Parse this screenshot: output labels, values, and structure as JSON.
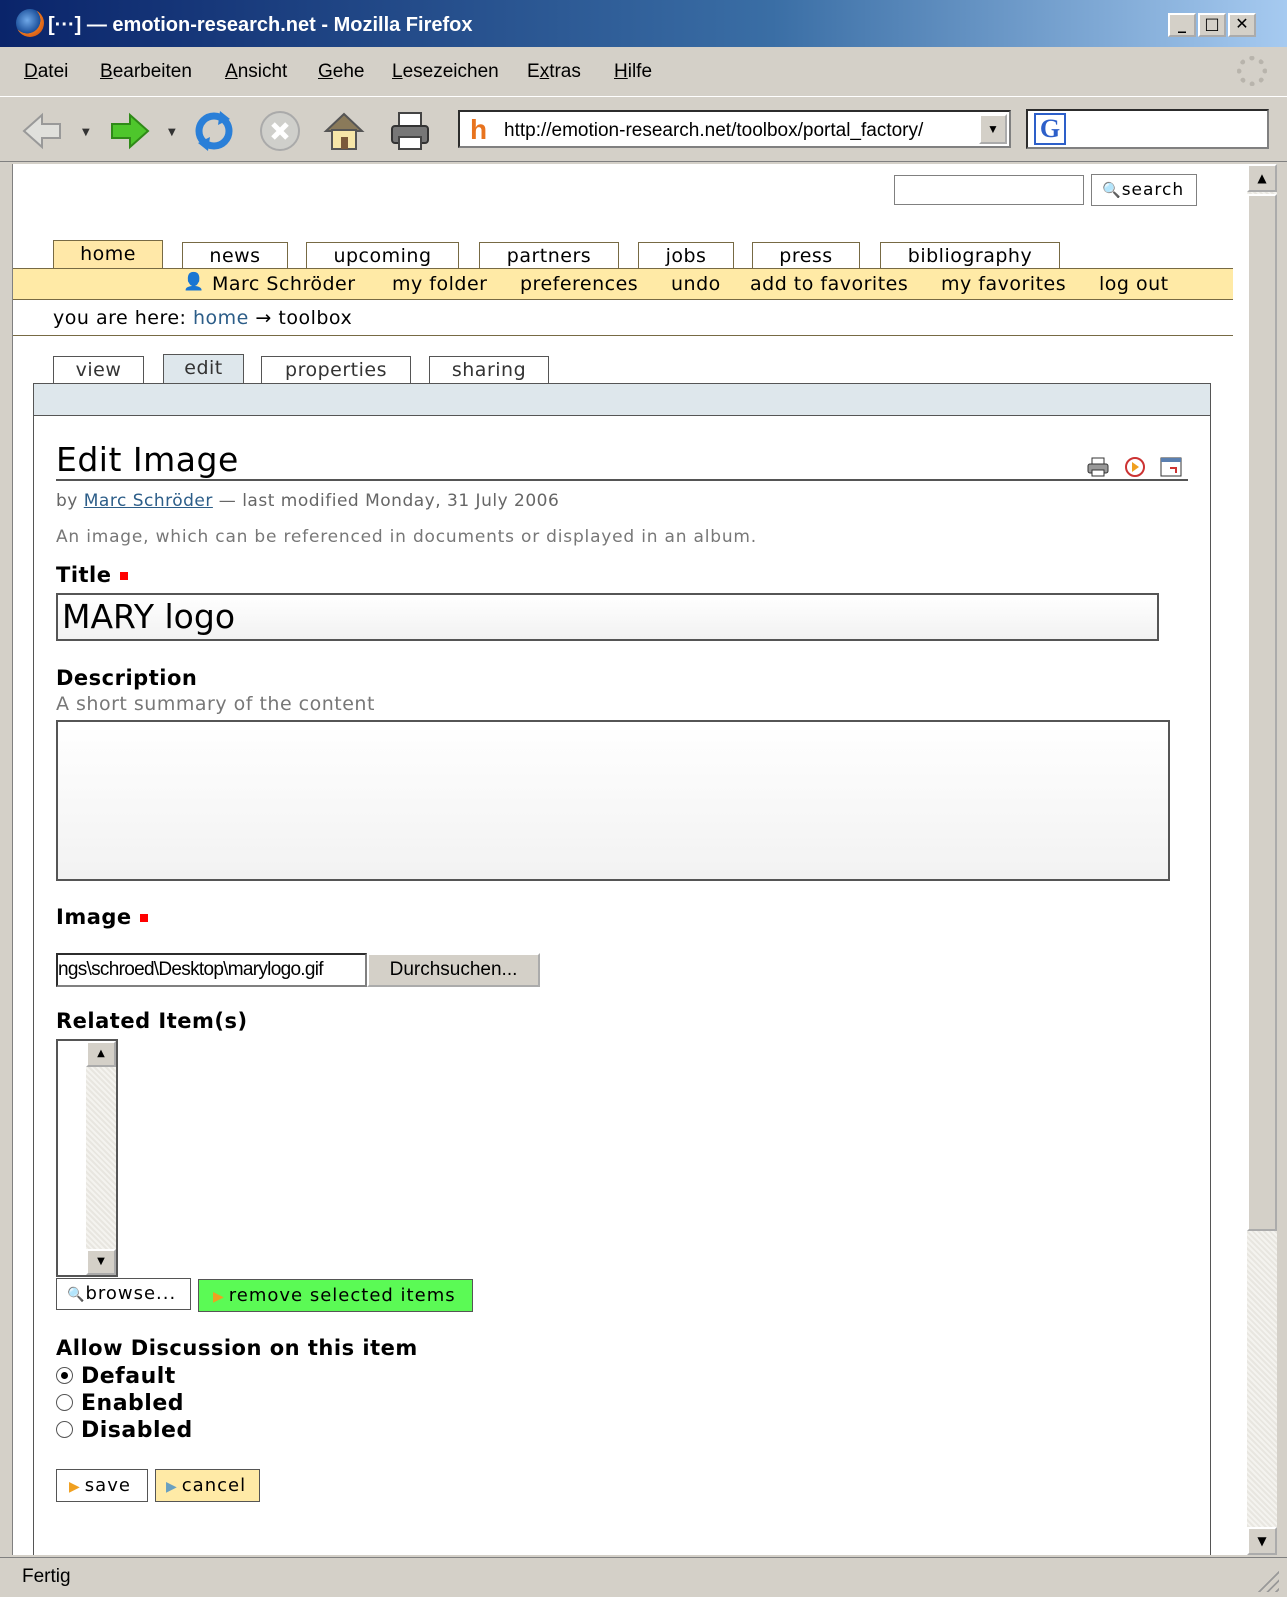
{
  "window": {
    "title": "[···] — emotion-research.net - Mozilla Firefox",
    "min_label": "_",
    "max_label": "□",
    "close_label": "✕"
  },
  "menu": [
    "Datei",
    "Bearbeiten",
    "Ansicht",
    "Gehe",
    "Lesezeichen",
    "Extras",
    "Hilfe"
  ],
  "menu_access_keys": [
    "D",
    "B",
    "A",
    "G",
    "L",
    "x",
    "H"
  ],
  "toolbar": {
    "url": "http://emotion-research.net/toolbox/portal_factory/",
    "url_icon": "h",
    "search_engine_icon": "G"
  },
  "site": {
    "search_button": "search",
    "global_tabs": [
      "home",
      "news",
      "upcoming",
      "partners",
      "jobs",
      "press",
      "bibliography"
    ],
    "selected_global_tab": "home",
    "user_actions": [
      "Marc Schröder",
      "my folder",
      "preferences",
      "undo",
      "add to favorites",
      "my favorites",
      "log out"
    ],
    "breadcrumb": {
      "prefix": "you are here:",
      "home": "home",
      "arrow": "→",
      "current": "toolbox"
    },
    "content_tabs": [
      "view",
      "edit",
      "properties",
      "sharing"
    ],
    "selected_content_tab": "edit"
  },
  "form": {
    "heading": "Edit Image",
    "byline_prefix": "by",
    "author": "Marc Schröder",
    "byline_suffix": "— last modified Monday, 31 July 2006",
    "type_description": "An image, which can be referenced in documents or displayed in an album.",
    "title_label": "Title",
    "title_value": "MARY logo",
    "description_label": "Description",
    "description_help": "A short summary of the content",
    "description_value": "",
    "image_label": "Image",
    "image_path": "ngs\\schroed\\Desktop\\marylogo.gif",
    "browse_file_button": "Durchsuchen...",
    "related_label": "Related Item(s)",
    "related_browse_button": "browse...",
    "remove_selected_button": "remove selected items",
    "discussion_label": "Allow Discussion on this item",
    "discussion_options": [
      "Default",
      "Enabled",
      "Disabled"
    ],
    "discussion_selected": "Default",
    "save_button": "save",
    "cancel_button": "cancel"
  },
  "status": "Fertig",
  "colors": {
    "selected_tab": "#ffe8a8",
    "user_bar": "#ffeaa6",
    "edit_bar": "#dee7ec",
    "link": "#2c5d88",
    "required": "#ff0000",
    "remove_button": "#5bfa55"
  },
  "icons": [
    "firefox-icon",
    "back-icon",
    "forward-icon",
    "reload-icon",
    "stop-icon",
    "home-icon",
    "print-icon",
    "user-icon",
    "print-page-icon",
    "send-page-icon",
    "full-screen-icon",
    "magnifier-icon"
  ]
}
